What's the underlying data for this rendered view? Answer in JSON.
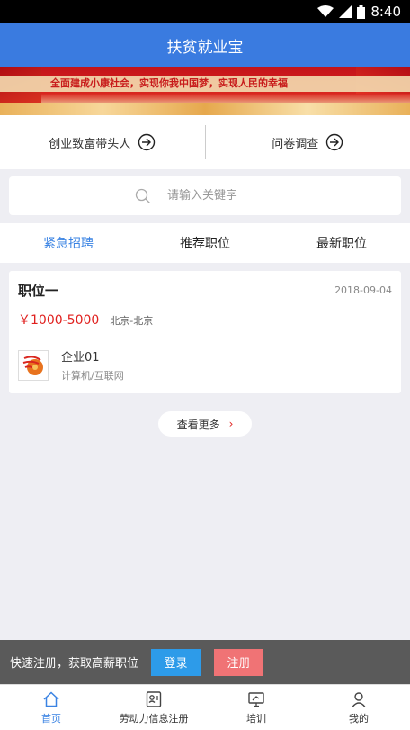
{
  "status_bar": {
    "time": "8:40"
  },
  "app_bar": {
    "title": "扶贫就业宝"
  },
  "banner": {
    "slogan": "全面建成小康社会，实现你我中国梦，实现人民的幸福"
  },
  "quick_links": [
    {
      "label": "创业致富带头人"
    },
    {
      "label": "问卷调查"
    }
  ],
  "search": {
    "placeholder": "请输入关键字"
  },
  "tabs": [
    {
      "label": "紧急招聘",
      "active": true
    },
    {
      "label": "推荐职位",
      "active": false
    },
    {
      "label": "最新职位",
      "active": false
    }
  ],
  "job": {
    "title": "职位一",
    "date": "2018-09-04",
    "salary": "￥1000-5000",
    "location": "北京-北京",
    "company_name": "企业01",
    "company_industry": "计算机/互联网"
  },
  "more_button": {
    "label": "查看更多",
    "chevron": "›"
  },
  "register_bar": {
    "text": "快速注册，获取高薪职位",
    "login_label": "登录",
    "register_label": "注册"
  },
  "bottom_nav": [
    {
      "label": "首页",
      "icon": "home-icon",
      "active": true
    },
    {
      "label": "劳动力信息注册",
      "icon": "id-card-icon",
      "active": false
    },
    {
      "label": "培训",
      "icon": "monitor-icon",
      "active": false
    },
    {
      "label": "我的",
      "icon": "person-icon",
      "active": false
    }
  ],
  "colors": {
    "primary": "#3a7be0",
    "accent_blue": "#3a83e3",
    "salary_red": "#e0201e",
    "login_button": "#2d9be9",
    "register_button": "#f07375"
  }
}
